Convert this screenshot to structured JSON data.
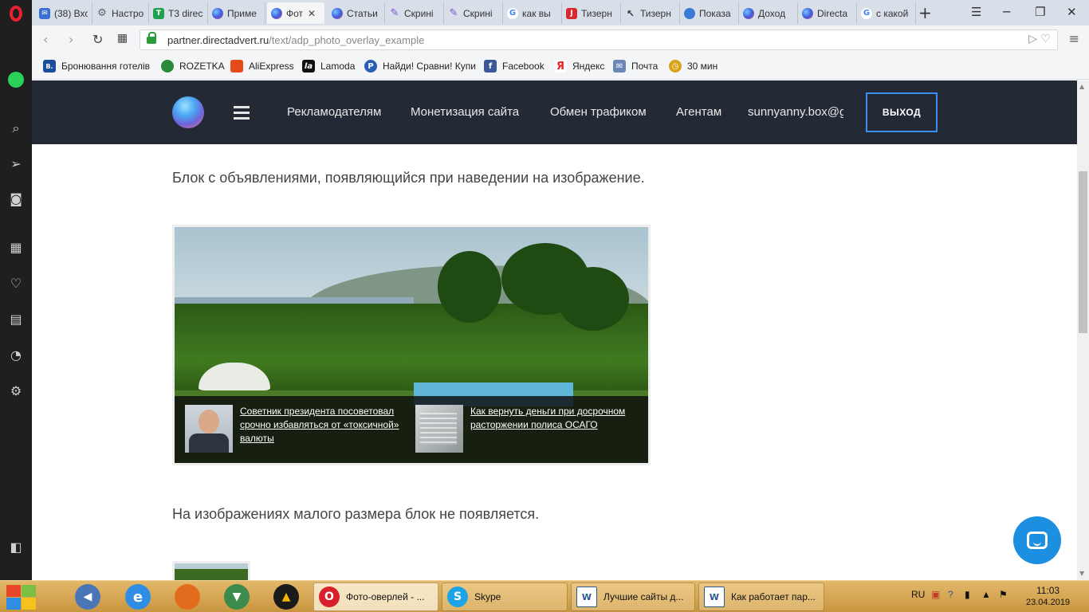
{
  "browser": {
    "tabs": [
      {
        "label": "(38) Вхо",
        "icon": "mail-icon"
      },
      {
        "label": "Настро",
        "icon": "gear-icon"
      },
      {
        "label": "T3 direc",
        "icon": "t3-icon"
      },
      {
        "label": "Приме",
        "icon": "directadvert-icon"
      },
      {
        "label": "Фот",
        "icon": "directadvert-icon",
        "active": true
      },
      {
        "label": "Статьи",
        "icon": "directadvert-icon"
      },
      {
        "label": "Скрині",
        "icon": "pen-icon"
      },
      {
        "label": "Скрині",
        "icon": "pen-icon"
      },
      {
        "label": "как вы",
        "icon": "google-icon"
      },
      {
        "label": "Тизерн",
        "icon": "j-icon"
      },
      {
        "label": "Тизерн",
        "icon": "cursor-icon"
      },
      {
        "label": "Показа",
        "icon": "globe-icon"
      },
      {
        "label": "Доход",
        "icon": "directadvert-icon"
      },
      {
        "label": "Directa",
        "icon": "directadvert-icon"
      },
      {
        "label": "с какой",
        "icon": "google-icon"
      }
    ],
    "url_domain": "partner.directadvert.ru",
    "url_path": "/text/adp_photo_overlay_example",
    "bookmarks": [
      {
        "label": "Бронювання готелів",
        "icon": "booking-icon",
        "color": "#1b4d9e",
        "glyph": "B."
      },
      {
        "label": "ROZETKA",
        "icon": "rozetka-icon",
        "color": "#2a8a3c",
        "glyph": ""
      },
      {
        "label": "AliExpress",
        "icon": "aliexpress-icon",
        "color": "#e64a19",
        "glyph": ""
      },
      {
        "label": "Lamoda",
        "icon": "lamoda-icon",
        "color": "#111111",
        "glyph": "la"
      },
      {
        "label": "Найди! Сравни! Купи",
        "icon": "price-icon",
        "color": "#2b5fb5",
        "glyph": "P"
      },
      {
        "label": "Facebook",
        "icon": "facebook-icon",
        "color": "#3b5998",
        "glyph": "f"
      },
      {
        "label": "Яндекс",
        "icon": "yandex-icon",
        "color": "#ffffff",
        "glyph": "Я"
      },
      {
        "label": "Почта",
        "icon": "mail-icon",
        "color": "#6c86b8",
        "glyph": "✉"
      },
      {
        "label": "30 мин",
        "icon": "clock-icon",
        "color": "#d9a21b",
        "glyph": "◷"
      }
    ]
  },
  "header": {
    "nav": [
      "Рекламодателям",
      "Монетизация сайта",
      "Обмен трафиком",
      "Агентам"
    ],
    "email": "sunnyanny.box@gmail.com",
    "logout": "ВЫХОД"
  },
  "content": {
    "intro": "Блок с объявлениями, появляющийся при наведении на изображение.",
    "ads": [
      {
        "title": "Советник президента посоветовал срочно избавляться от «токсичной» валюты"
      },
      {
        "title": "Как вернуть деньги при досрочном расторжении полиса ОСАГО"
      }
    ],
    "small_note": "На изображениях малого размера блок не появляется."
  },
  "taskbar": {
    "tasks": [
      {
        "label": "Фото-оверлей - ...",
        "icon": "opera-icon"
      },
      {
        "label": "Skype",
        "icon": "skype-icon"
      },
      {
        "label": "Лучшие сайты д...",
        "icon": "word-icon"
      },
      {
        "label": "Как работает пар...",
        "icon": "word-icon"
      }
    ],
    "lang": "RU",
    "time": "11:03",
    "date": "23.04.2019"
  }
}
